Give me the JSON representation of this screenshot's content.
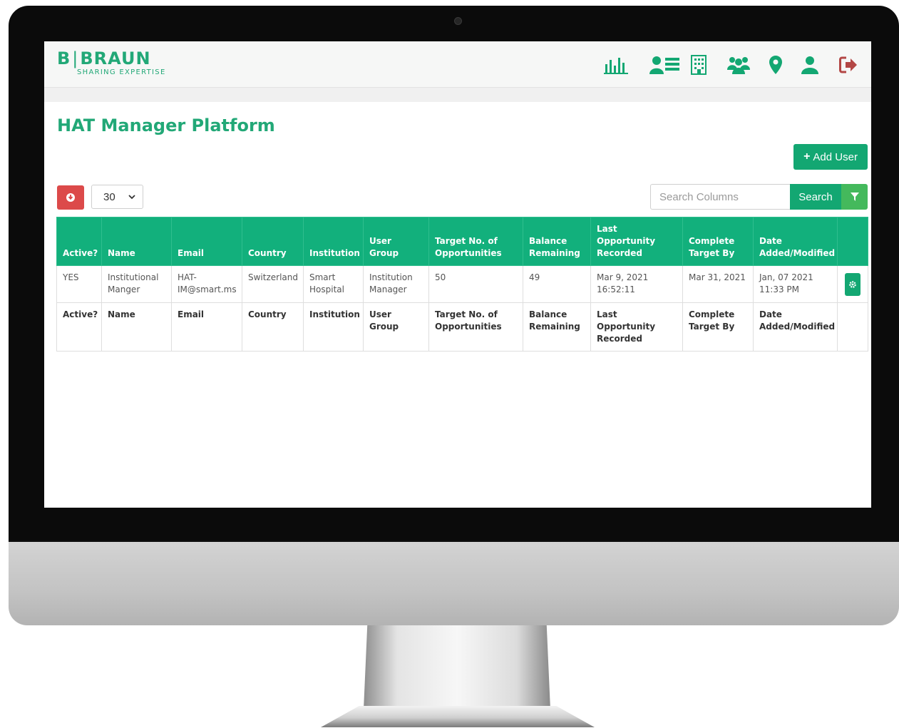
{
  "brand": {
    "name_left": "B",
    "name_right": "BRAUN",
    "tagline": "SHARING EXPERTISE",
    "accent_color": "#13a772"
  },
  "nav": {
    "icons": [
      "bar-chart-icon",
      "user-list-icon",
      "building-icon",
      "users-group-icon",
      "map-pin-icon",
      "user-profile-icon",
      "logout-icon"
    ]
  },
  "page": {
    "title": "HAT Manager Platform"
  },
  "toolbar": {
    "add_user_label": "Add User",
    "page_size": "30",
    "search_placeholder": "Search Columns",
    "search_label": "Search"
  },
  "table": {
    "headers": [
      "Active?",
      "Name",
      "Email",
      "Country",
      "Institution",
      "User Group",
      "Target No. of Opportunities",
      "Balance Remaining",
      "Last Opportunity Recorded",
      "Complete Target By",
      "Date Added/Modified"
    ],
    "rows": [
      {
        "active": "YES",
        "name": "Institutional Manger",
        "email": "HAT-IM@smart.ms",
        "country": "Switzerland",
        "institution": "Smart Hospital",
        "user_group": "Institution Manager",
        "target": "50",
        "balance": "49",
        "last_recorded": "Mar 9, 2021 16:52:11",
        "complete_by": "Mar 31, 2021",
        "date_modified": "Jan, 07 2021 11:33 PM"
      }
    ]
  }
}
